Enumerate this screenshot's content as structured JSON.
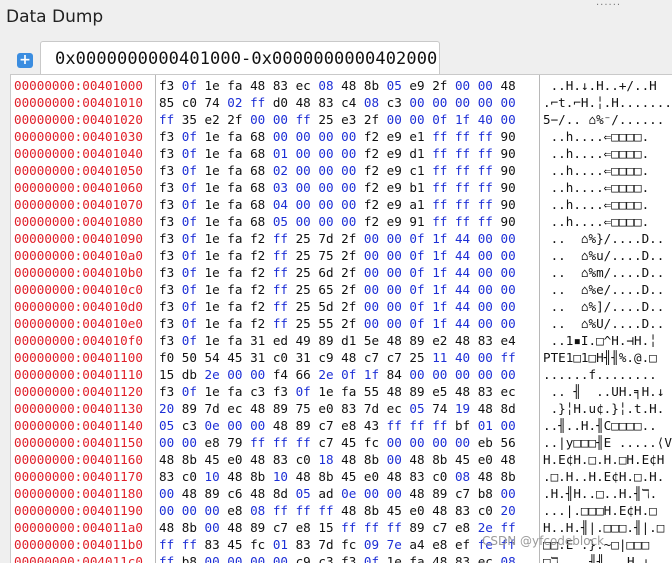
{
  "window": {
    "title": "Data Dump"
  },
  "tab": {
    "label": "0x0000000000401000-0x0000000000402000",
    "add_label": "+"
  },
  "dump": {
    "rows": [
      {
        "addr": "00000000:00401000",
        "bytes": [
          "f3",
          "0f",
          "1e",
          "fa",
          "48",
          "83",
          "ec",
          "08",
          "48",
          "8b",
          "05",
          "e9",
          "2f",
          "00",
          "00",
          "48"
        ],
        "ascii": " ..H.↓.H..+/..H"
      },
      {
        "addr": "00000000:00401010",
        "bytes": [
          "85",
          "c0",
          "74",
          "02",
          "ff",
          "d0",
          "48",
          "83",
          "c4",
          "08",
          "c3",
          "00",
          "00",
          "00",
          "00",
          "00"
        ],
        "ascii": ".⌐t.⌐H.╎.H......."
      },
      {
        "addr": "00000000:00401020",
        "bytes": [
          "ff",
          "35",
          "e2",
          "2f",
          "00",
          "00",
          "ff",
          "25",
          "e3",
          "2f",
          "00",
          "00",
          "0f",
          "1f",
          "40",
          "00"
        ],
        "ascii": "5−/.. ⌂%⁻/......"
      },
      {
        "addr": "00000000:00401030",
        "bytes": [
          "f3",
          "0f",
          "1e",
          "fa",
          "68",
          "00",
          "00",
          "00",
          "00",
          "f2",
          "e9",
          "e1",
          "ff",
          "ff",
          "ff",
          "90"
        ],
        "ascii": " ..h....⇐□□□□."
      },
      {
        "addr": "00000000:00401040",
        "bytes": [
          "f3",
          "0f",
          "1e",
          "fa",
          "68",
          "01",
          "00",
          "00",
          "00",
          "f2",
          "e9",
          "d1",
          "ff",
          "ff",
          "ff",
          "90"
        ],
        "ascii": " ..h....⇐□□□□."
      },
      {
        "addr": "00000000:00401050",
        "bytes": [
          "f3",
          "0f",
          "1e",
          "fa",
          "68",
          "02",
          "00",
          "00",
          "00",
          "f2",
          "e9",
          "c1",
          "ff",
          "ff",
          "ff",
          "90"
        ],
        "ascii": " ..h....⇐□□□□."
      },
      {
        "addr": "00000000:00401060",
        "bytes": [
          "f3",
          "0f",
          "1e",
          "fa",
          "68",
          "03",
          "00",
          "00",
          "00",
          "f2",
          "e9",
          "b1",
          "ff",
          "ff",
          "ff",
          "90"
        ],
        "ascii": " ..h....⇐□□□□."
      },
      {
        "addr": "00000000:00401070",
        "bytes": [
          "f3",
          "0f",
          "1e",
          "fa",
          "68",
          "04",
          "00",
          "00",
          "00",
          "f2",
          "e9",
          "a1",
          "ff",
          "ff",
          "ff",
          "90"
        ],
        "ascii": " ..h....⇐□□□□."
      },
      {
        "addr": "00000000:00401080",
        "bytes": [
          "f3",
          "0f",
          "1e",
          "fa",
          "68",
          "05",
          "00",
          "00",
          "00",
          "f2",
          "e9",
          "91",
          "ff",
          "ff",
          "ff",
          "90"
        ],
        "ascii": " ..h....⇐□□□□."
      },
      {
        "addr": "00000000:00401090",
        "bytes": [
          "f3",
          "0f",
          "1e",
          "fa",
          "f2",
          "ff",
          "25",
          "7d",
          "2f",
          "00",
          "00",
          "0f",
          "1f",
          "44",
          "00",
          "00"
        ],
        "ascii": " ..  ⌂%}/....D.."
      },
      {
        "addr": "00000000:004010a0",
        "bytes": [
          "f3",
          "0f",
          "1e",
          "fa",
          "f2",
          "ff",
          "25",
          "75",
          "2f",
          "00",
          "00",
          "0f",
          "1f",
          "44",
          "00",
          "00"
        ],
        "ascii": " ..  ⌂%u/....D.."
      },
      {
        "addr": "00000000:004010b0",
        "bytes": [
          "f3",
          "0f",
          "1e",
          "fa",
          "f2",
          "ff",
          "25",
          "6d",
          "2f",
          "00",
          "00",
          "0f",
          "1f",
          "44",
          "00",
          "00"
        ],
        "ascii": " ..  ⌂%m/....D.."
      },
      {
        "addr": "00000000:004010c0",
        "bytes": [
          "f3",
          "0f",
          "1e",
          "fa",
          "f2",
          "ff",
          "25",
          "65",
          "2f",
          "00",
          "00",
          "0f",
          "1f",
          "44",
          "00",
          "00"
        ],
        "ascii": " ..  ⌂%e/....D.."
      },
      {
        "addr": "00000000:004010d0",
        "bytes": [
          "f3",
          "0f",
          "1e",
          "fa",
          "f2",
          "ff",
          "25",
          "5d",
          "2f",
          "00",
          "00",
          "0f",
          "1f",
          "44",
          "00",
          "00"
        ],
        "ascii": " ..  ⌂%]/....D.."
      },
      {
        "addr": "00000000:004010e0",
        "bytes": [
          "f3",
          "0f",
          "1e",
          "fa",
          "f2",
          "ff",
          "25",
          "55",
          "2f",
          "00",
          "00",
          "0f",
          "1f",
          "44",
          "00",
          "00"
        ],
        "ascii": " ..  ⌂%U/....D.."
      },
      {
        "addr": "00000000:004010f0",
        "bytes": [
          "f3",
          "0f",
          "1e",
          "fa",
          "31",
          "ed",
          "49",
          "89",
          "d1",
          "5e",
          "48",
          "89",
          "e2",
          "48",
          "83",
          "e4"
        ],
        "ascii": " ..1▪I.□^H.⊣H.╎"
      },
      {
        "addr": "00000000:00401100",
        "bytes": [
          "f0",
          "50",
          "54",
          "45",
          "31",
          "c0",
          "31",
          "c9",
          "48",
          "c7",
          "c7",
          "25",
          "11",
          "40",
          "00",
          "ff"
        ],
        "ascii": "PTE1□1□H╢╢%.@.□"
      },
      {
        "addr": "00000000:00401110",
        "bytes": [
          "15",
          "db",
          "2e",
          "00",
          "00",
          "f4",
          "66",
          "2e",
          "0f",
          "1f",
          "84",
          "00",
          "00",
          "00",
          "00",
          "00"
        ],
        "ascii": "......f........"
      },
      {
        "addr": "00000000:00401120",
        "bytes": [
          "f3",
          "0f",
          "1e",
          "fa",
          "c3",
          "f3",
          "0f",
          "1e",
          "fa",
          "55",
          "48",
          "89",
          "e5",
          "48",
          "83",
          "ec"
        ],
        "ascii": " .. ╢  ..UH.╕H.↓"
      },
      {
        "addr": "00000000:00401130",
        "bytes": [
          "20",
          "89",
          "7d",
          "ec",
          "48",
          "89",
          "75",
          "e0",
          "83",
          "7d",
          "ec",
          "05",
          "74",
          "19",
          "48",
          "8d"
        ],
        "ascii": " .}╎H.u¢.}╎.t.H."
      },
      {
        "addr": "00000000:00401140",
        "bytes": [
          "05",
          "c3",
          "0e",
          "00",
          "00",
          "48",
          "89",
          "c7",
          "e8",
          "43",
          "ff",
          "ff",
          "ff",
          "bf",
          "01",
          "00"
        ],
        "ascii": "..╢..H.╢C□□□□.."
      },
      {
        "addr": "00000000:00401150",
        "bmtes": [],
        "bytes": [
          "00",
          "00",
          "e8",
          "79",
          "ff",
          "ff",
          "ff",
          "c7",
          "45",
          "fc",
          "00",
          "00",
          "00",
          "00",
          "eb",
          "56"
        ],
        "ascii": "..|y□□□╢E .....⟨V"
      },
      {
        "addr": "00000000:00401160",
        "bytes": [
          "48",
          "8b",
          "45",
          "e0",
          "48",
          "83",
          "c0",
          "18",
          "48",
          "8b",
          "00",
          "48",
          "8b",
          "45",
          "e0",
          "48"
        ],
        "ascii": "H.E¢H.□.H.□H.E¢H"
      },
      {
        "addr": "00000000:00401170",
        "bytes": [
          "83",
          "c0",
          "10",
          "48",
          "8b",
          "10",
          "48",
          "8b",
          "45",
          "e0",
          "48",
          "83",
          "c0",
          "08",
          "48",
          "8b"
        ],
        "ascii": ".□.H..H.E¢H.□.H."
      },
      {
        "addr": "00000000:00401180",
        "bytes": [
          "00",
          "48",
          "89",
          "c6",
          "48",
          "8d",
          "05",
          "ad",
          "0e",
          "00",
          "00",
          "48",
          "89",
          "c7",
          "b8",
          "00"
        ],
        "ascii": ".H.╢H..□..H.╢ℸ."
      },
      {
        "addr": "00000000:00401190",
        "bytes": [
          "00",
          "00",
          "00",
          "e8",
          "08",
          "ff",
          "ff",
          "ff",
          "48",
          "8b",
          "45",
          "e0",
          "48",
          "83",
          "c0",
          "20"
        ],
        "ascii": "...|.□□□H.E¢H.□ "
      },
      {
        "addr": "00000000:004011a0",
        "bytes": [
          "48",
          "8b",
          "00",
          "48",
          "89",
          "c7",
          "e8",
          "15",
          "ff",
          "ff",
          "ff",
          "89",
          "c7",
          "e8",
          "2e",
          "ff"
        ],
        "ascii": "H..H.╢|.□□□.╢|.□"
      },
      {
        "addr": "00000000:004011b0",
        "bytes": [
          "ff",
          "ff",
          "83",
          "45",
          "fc",
          "01",
          "83",
          "7d",
          "fc",
          "09",
          "7e",
          "a4",
          "e8",
          "ef",
          "fe",
          "ff"
        ],
        "ascii": "□□.E .}.~□|□□□"
      },
      {
        "addr": "00000000:004011c0",
        "bytes": [
          "ff",
          "b8",
          "00",
          "00",
          "00",
          "00",
          "c9",
          "c3",
          "f3",
          "0f",
          "1e",
          "fa",
          "48",
          "83",
          "ec",
          "08"
        ],
        "ascii": "□ℸ....╢╢ ..H.↓."
      }
    ]
  },
  "watermark": "CSDN @yfcodeblock",
  "colors": {
    "address": "#e0202a",
    "zero_byte": "#1d2fd6",
    "byte": "#111111"
  }
}
